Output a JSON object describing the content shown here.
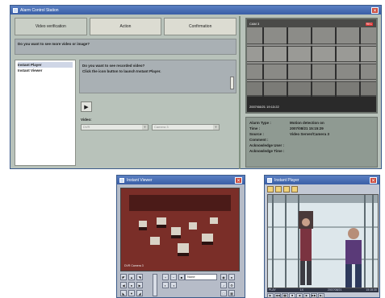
{
  "acs": {
    "title": "Alarm Control Station",
    "close_glyph": "✕",
    "tabs": [
      {
        "label": "Video verification"
      },
      {
        "label": "Action"
      },
      {
        "label": "Confirmation"
      }
    ],
    "question": "Do you want to see more video or image?",
    "tree_items": [
      {
        "label": "Instant Player"
      },
      {
        "label": "Instant Viewer"
      }
    ],
    "info_lines": [
      "Do you want to see recorded video?",
      "Click the icon button to launch Instant Player."
    ],
    "launch_icon": "launch-player-icon",
    "video_label": "Video:",
    "select1_value": "DVR",
    "select2_value": "Camera 3",
    "camera": {
      "label": "CAM 3",
      "rec_badge": "REC",
      "timestamp": "2007/08/21 19:13:22"
    },
    "details": [
      {
        "k": "Alarm Type :",
        "v": "Motion detection on"
      },
      {
        "k": "Time :",
        "v": "2007/08/21 15:15:29"
      },
      {
        "k": "Source :",
        "v": "Video Server/Camera 3"
      },
      {
        "k": "Comment :",
        "v": ""
      },
      {
        "k": "Acknowledge User :",
        "v": ""
      },
      {
        "k": "Acknowledge Time :",
        "v": ""
      }
    ]
  },
  "iv": {
    "title": "Instant Viewer",
    "caption": "DVR Camera 3",
    "select_value": "None"
  },
  "ip": {
    "title": "Instant Player",
    "status_left": "PLAY",
    "status_mid": "1X",
    "status_date": "2007/08/21",
    "status_time": "15:15:30"
  },
  "colors": {
    "titlebar": "#3a5ea6",
    "window_bg": "#b8c2ba",
    "close": "#c9473a"
  }
}
